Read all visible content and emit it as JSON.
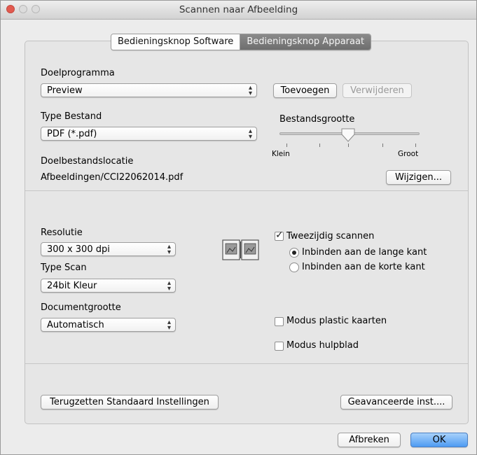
{
  "window": {
    "title": "Scannen naar Afbeelding"
  },
  "tabs": [
    {
      "label": "Bedieningsknop Software",
      "selected": true
    },
    {
      "label": "Bedieningsknop Apparaat",
      "selected": false
    }
  ],
  "target_app": {
    "label": "Doelprogramma",
    "value": "Preview",
    "add_button": "Toevoegen",
    "remove_button": "Verwijderen"
  },
  "file_type": {
    "label": "Type Bestand",
    "value": "PDF (*.pdf)"
  },
  "file_size": {
    "label": "Bestandsgrootte",
    "min_label": "Klein",
    "max_label": "Groot",
    "level": 0.5
  },
  "destination": {
    "label": "Doelbestandslocatie",
    "value": "Afbeeldingen/CCI22062014.pdf",
    "change_button": "Wijzigen..."
  },
  "resolution": {
    "label": "Resolutie",
    "value": "300 x 300 dpi"
  },
  "scan_type": {
    "label": "Type Scan",
    "value": "24bit Kleur"
  },
  "document_size": {
    "label": "Documentgrootte",
    "value": "Automatisch"
  },
  "duplex": {
    "label": "Tweezijdig scannen",
    "checked": true,
    "options": [
      {
        "label": "Inbinden aan de lange kant",
        "selected": true
      },
      {
        "label": "Inbinden aan de korte kant",
        "selected": false
      }
    ]
  },
  "plastic_card": {
    "label": "Modus plastic kaarten",
    "checked": false
  },
  "carrier_sheet": {
    "label": "Modus hulpblad",
    "checked": false
  },
  "restore_button": "Terugzetten Standaard Instellingen",
  "advanced_button": "Geavanceerde inst....",
  "cancel_button": "Afbreken",
  "ok_button": "OK",
  "colors": {
    "accent": "#4e9bf2",
    "close": "#e25a4f",
    "tab_inactive": "#7a7a7a"
  }
}
